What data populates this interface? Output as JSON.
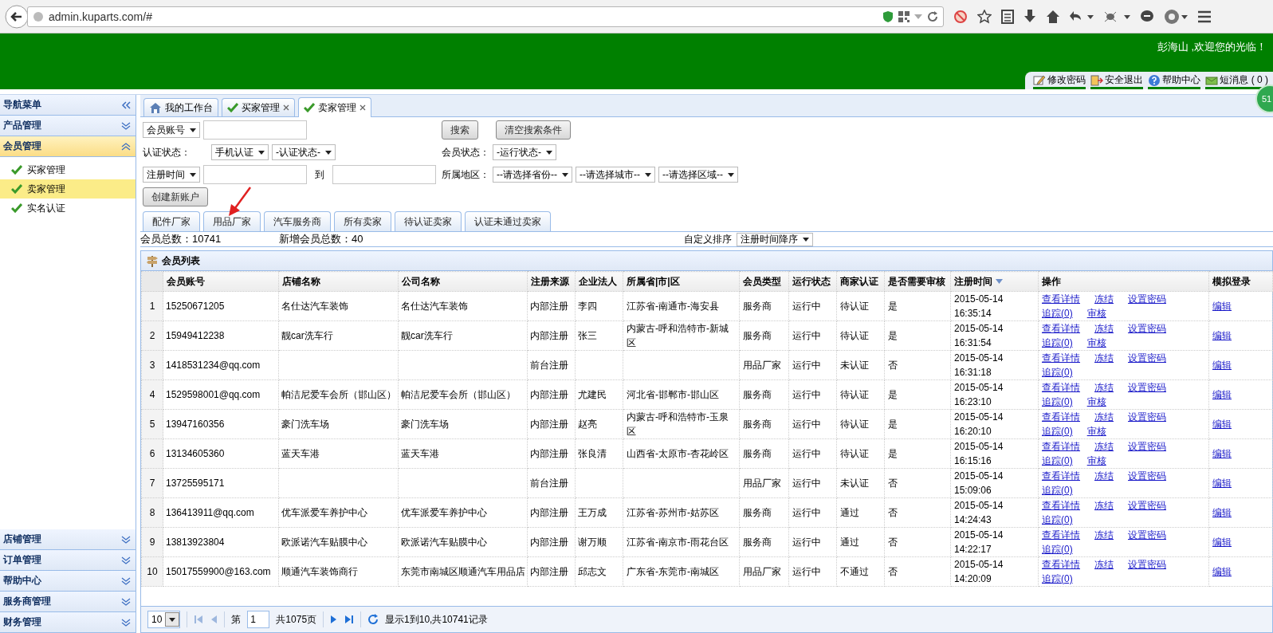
{
  "browser": {
    "url": "admin.kuparts.com/#"
  },
  "header": {
    "welcome": "彭海山 ,欢迎您的光临！",
    "links": [
      {
        "label": "修改密码",
        "kind": "password"
      },
      {
        "label": "安全退出",
        "kind": "logout"
      },
      {
        "label": "帮助中心",
        "kind": "help"
      },
      {
        "label": "短消息 ( 0 )",
        "kind": "messages"
      }
    ],
    "badge": "51"
  },
  "sidebar": {
    "title": "导航菜单",
    "sections": [
      {
        "label": "产品管理",
        "expanded": false
      },
      {
        "label": "会员管理",
        "expanded": true,
        "items": [
          {
            "label": "买家管理",
            "selected": false
          },
          {
            "label": "卖家管理",
            "selected": true
          },
          {
            "label": "实名认证",
            "selected": false
          }
        ]
      },
      {
        "label": "店铺管理",
        "expanded": false
      },
      {
        "label": "订单管理",
        "expanded": false
      },
      {
        "label": "帮助中心",
        "expanded": false
      },
      {
        "label": "服务商管理",
        "expanded": false
      },
      {
        "label": "财务管理",
        "expanded": false
      }
    ]
  },
  "tabs": [
    {
      "label": "我的工作台",
      "kind": "home",
      "closable": false,
      "selected": false
    },
    {
      "label": "买家管理",
      "kind": "page",
      "closable": true,
      "selected": false
    },
    {
      "label": "卖家管理",
      "kind": "page",
      "closable": true,
      "selected": true
    }
  ],
  "search": {
    "account_select": "会员账号",
    "search_button": "搜索",
    "clear_button": "清空搜索条件",
    "cert_label": "认证状态：",
    "cert_selects": [
      "手机认证",
      "-认证状态-"
    ],
    "status_label": "会员状态：",
    "status_select": "-运行状态-",
    "time_select": "注册时间",
    "to_label": "到",
    "region_label": "所属地区：",
    "region_selects": [
      "--请选择省份--",
      "--请选择城市--",
      "--请选择区域--"
    ],
    "create_button": "创建新账户"
  },
  "seller_tabs": [
    {
      "label": "配件厂家",
      "selected": false
    },
    {
      "label": "用品厂家",
      "selected": false
    },
    {
      "label": "汽车服务商",
      "selected": false
    },
    {
      "label": "所有卖家",
      "selected": false
    },
    {
      "label": "待认证卖家",
      "selected": false
    },
    {
      "label": "认证未通过卖家",
      "selected": false
    }
  ],
  "summary": {
    "total": "会员总数：10741",
    "new_members": "新增会员总数：40",
    "sort_label": "自定义排序",
    "sort_select": "注册时间降序"
  },
  "table": {
    "title": "会员列表",
    "columns": [
      {
        "kind": "index"
      },
      {
        "label": "会员账号"
      },
      {
        "label": "店铺名称"
      },
      {
        "label": "公司名称"
      },
      {
        "label": "注册来源"
      },
      {
        "label": "企业法人"
      },
      {
        "label": "所属省|市|区"
      },
      {
        "label": "会员类型"
      },
      {
        "label": "运行状态"
      },
      {
        "label": "商家认证"
      },
      {
        "label": "是否需要审核"
      },
      {
        "label": "注册时间",
        "sorted_descending": true
      },
      {
        "label": "操作"
      },
      {
        "label": "模拟登录"
      }
    ],
    "rows": [
      {
        "cells": [
          "1",
          "15250671205",
          "名仕达汽车装饰",
          "名仕达汽车装饰",
          "内部注册",
          "李四",
          "江苏省-南通市-海安县",
          "服务商",
          "运行中",
          "待认证",
          "是",
          "2015-05-14 16:35:14"
        ],
        "ops": [
          "查看详情",
          "冻结",
          "设置密码",
          "追踪(0)",
          "审核"
        ],
        "login": "编辑"
      },
      {
        "cells": [
          "2",
          "15949412238",
          "靓car洗车行",
          "靓car洗车行",
          "内部注册",
          "张三",
          "内蒙古-呼和浩特市-新城区",
          "服务商",
          "运行中",
          "待认证",
          "是",
          "2015-05-14 16:31:54"
        ],
        "ops": [
          "查看详情",
          "冻结",
          "设置密码",
          "追踪(0)",
          "审核"
        ],
        "login": "编辑"
      },
      {
        "cells": [
          "3",
          "1418531234@qq.com",
          "",
          "",
          "前台注册",
          "",
          "",
          "用品厂家",
          "运行中",
          "未认证",
          "否",
          "2015-05-14 16:31:18"
        ],
        "ops": [
          "查看详情",
          "冻结",
          "设置密码",
          "追踪(0)"
        ],
        "login": "编辑"
      },
      {
        "cells": [
          "4",
          "1529598001@qq.com",
          "帕洁尼爱车会所（邯山区）",
          "帕洁尼爱车会所（邯山区）",
          "内部注册",
          "尤建民",
          "河北省-邯郸市-邯山区",
          "服务商",
          "运行中",
          "待认证",
          "是",
          "2015-05-14 16:23:10"
        ],
        "ops": [
          "查看详情",
          "冻结",
          "设置密码",
          "追踪(0)",
          "审核"
        ],
        "login": "编辑"
      },
      {
        "cells": [
          "5",
          "13947160356",
          "豪门洗车场",
          "豪门洗车场",
          "内部注册",
          "赵亮",
          "内蒙古-呼和浩特市-玉泉区",
          "服务商",
          "运行中",
          "待认证",
          "是",
          "2015-05-14 16:20:10"
        ],
        "ops": [
          "查看详情",
          "冻结",
          "设置密码",
          "追踪(0)",
          "审核"
        ],
        "login": "编辑"
      },
      {
        "cells": [
          "6",
          "13134605360",
          "蓝天车港",
          "蓝天车港",
          "内部注册",
          "张良清",
          "山西省-太原市-杏花岭区",
          "服务商",
          "运行中",
          "待认证",
          "是",
          "2015-05-14 16:15:16"
        ],
        "ops": [
          "查看详情",
          "冻结",
          "设置密码",
          "追踪(0)",
          "审核"
        ],
        "login": "编辑"
      },
      {
        "cells": [
          "7",
          "13725595171",
          "",
          "",
          "前台注册",
          "",
          "",
          "用品厂家",
          "运行中",
          "未认证",
          "否",
          "2015-05-14 15:09:06"
        ],
        "ops": [
          "查看详情",
          "冻结",
          "设置密码",
          "追踪(0)"
        ],
        "login": "编辑"
      },
      {
        "cells": [
          "8",
          "136413911@qq.com",
          "优车派爱车养护中心",
          "优车派爱车养护中心",
          "内部注册",
          "王万成",
          "江苏省-苏州市-姑苏区",
          "服务商",
          "运行中",
          "通过",
          "否",
          "2015-05-14 14:24:43"
        ],
        "ops": [
          "查看详情",
          "冻结",
          "设置密码",
          "追踪(0)"
        ],
        "login": "编辑"
      },
      {
        "cells": [
          "9",
          "13813923804",
          "欧派诺汽车贴膜中心",
          "欧派诺汽车贴膜中心",
          "内部注册",
          "谢万顺",
          "江苏省-南京市-雨花台区",
          "服务商",
          "运行中",
          "通过",
          "否",
          "2015-05-14 14:22:17"
        ],
        "ops": [
          "查看详情",
          "冻结",
          "设置密码",
          "追踪(0)"
        ],
        "login": "编辑"
      },
      {
        "cells": [
          "10",
          "15017559900@163.com",
          "顺通汽车装饰商行",
          "东莞市南城区顺通汽车用品店",
          "内部注册",
          "邱志文",
          "广东省-东莞市-南城区",
          "用品厂家",
          "运行中",
          "不通过",
          "否",
          "2015-05-14 14:20:09"
        ],
        "ops": [
          "查看详情",
          "冻结",
          "设置密码",
          "追踪(0)"
        ],
        "login": "编辑"
      }
    ]
  },
  "pager": {
    "page_size": "10",
    "page_label": "第",
    "page": "1",
    "pages": "共1075页",
    "info": "显示1到10,共10741记录"
  }
}
